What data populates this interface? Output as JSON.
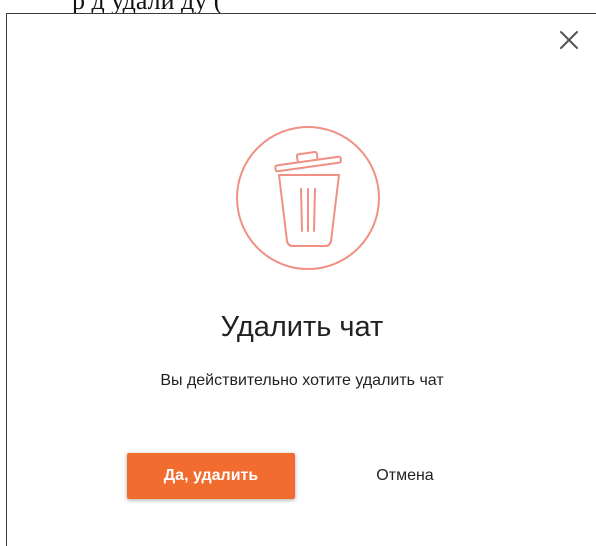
{
  "background_fragment": {
    "text": "р д                         удали                       ду (  "
  },
  "dialog": {
    "close_icon": "close-icon",
    "illustration_icon": "trash-can-icon",
    "title": "Удалить чат",
    "message": "Вы действительно хотите удалить чат",
    "confirm_label": "Да, удалить",
    "cancel_label": "Отмена"
  },
  "colors": {
    "accent": "#f26b2f",
    "icon_stroke": "#f08f83",
    "text": "#222222",
    "close_icon": "#555555"
  }
}
